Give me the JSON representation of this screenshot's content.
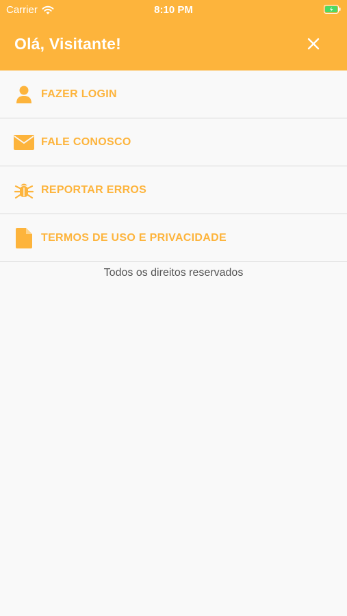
{
  "status_bar": {
    "carrier": "Carrier",
    "time": "8:10 PM"
  },
  "header": {
    "title": "Olá, Visitante!",
    "background": "#fdb43c"
  },
  "menu": {
    "accent": "#fdb43c",
    "items": [
      {
        "icon": "user-icon",
        "label": "FAZER LOGIN"
      },
      {
        "icon": "envelope-icon",
        "label": "FALE CONOSCO"
      },
      {
        "icon": "bug-icon",
        "label": "REPORTAR ERROS"
      },
      {
        "icon": "document-icon",
        "label": "TERMOS DE USO E PRIVACIDADE"
      }
    ]
  },
  "footer": {
    "text": "Todos os direitos reservados"
  }
}
